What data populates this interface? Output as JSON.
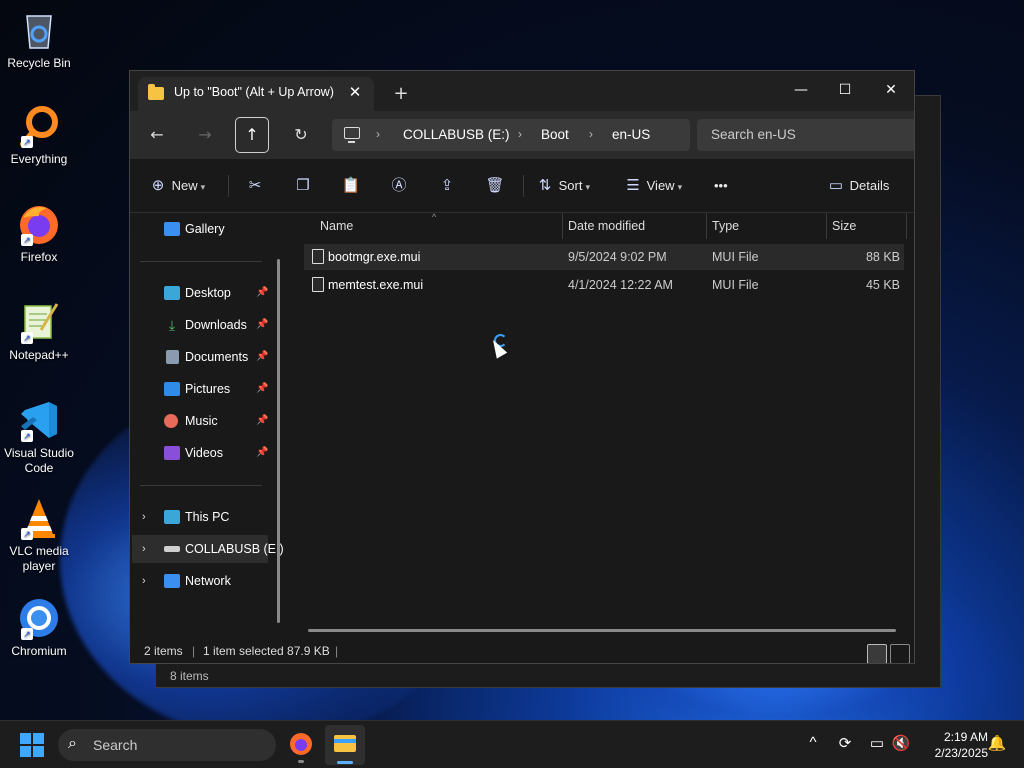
{
  "desktop": {
    "icons": [
      {
        "label": "Recycle Bin"
      },
      {
        "label": "Everything"
      },
      {
        "label": "Firefox"
      },
      {
        "label": "Notepad++"
      },
      {
        "label": "Visual Studio Code"
      },
      {
        "label": "VLC media player"
      },
      {
        "label": "Chromium"
      }
    ]
  },
  "background_window": {
    "status": "8 items"
  },
  "window": {
    "tab_title": "Up to \"Boot\" (Alt + Up Arrow)",
    "tab_close": "✕",
    "new_tab": "+",
    "controls": {
      "minimize": "—",
      "maximize": "☐",
      "close": "✕"
    },
    "nav": {
      "back": "←",
      "forward": "→",
      "up": "↑",
      "refresh": "↻"
    },
    "breadcrumb": {
      "chevron": "›",
      "items": [
        "COLLABUSB (E:)",
        "Boot",
        "en-US"
      ]
    },
    "search_placeholder": "Search en-US",
    "toolbar": {
      "new": "New",
      "sort": "Sort",
      "view": "View",
      "more": "•••",
      "details": "Details"
    },
    "nav_pane": {
      "gallery": "Gallery",
      "quick_access": [
        {
          "label": "Desktop",
          "pin": "📌"
        },
        {
          "label": "Downloads",
          "pin": "📌"
        },
        {
          "label": "Documents",
          "pin": "📌"
        },
        {
          "label": "Pictures",
          "pin": "📌"
        },
        {
          "label": "Music",
          "pin": "📌"
        },
        {
          "label": "Videos",
          "pin": "📌"
        }
      ],
      "expand_chevron": "›",
      "locations": [
        {
          "label": "This PC"
        },
        {
          "label": "COLLABUSB (E:)"
        },
        {
          "label": "Network"
        }
      ]
    },
    "columns": {
      "name": "Name",
      "date": "Date modified",
      "type": "Type",
      "size": "Size",
      "sort_caret": "^"
    },
    "files": [
      {
        "name": "bootmgr.exe.mui",
        "date": "9/5/2024 9:02 PM",
        "type": "MUI File",
        "size": "88 KB"
      },
      {
        "name": "memtest.exe.mui",
        "date": "4/1/2024 12:22 AM",
        "type": "MUI File",
        "size": "45 KB"
      }
    ],
    "status": {
      "items": "2 items",
      "selected": "1 item selected  87.9 KB",
      "divider": "|"
    }
  },
  "taskbar": {
    "search_label": "Search",
    "search_icon": "⌕",
    "tray": {
      "chevron": "^",
      "notification": "🔔"
    },
    "time": "2:19 AM",
    "date": "2/23/2025"
  },
  "colors": {
    "accent": "#3ea8ff",
    "folder": "#f6c343",
    "window_bg": "#191919"
  }
}
